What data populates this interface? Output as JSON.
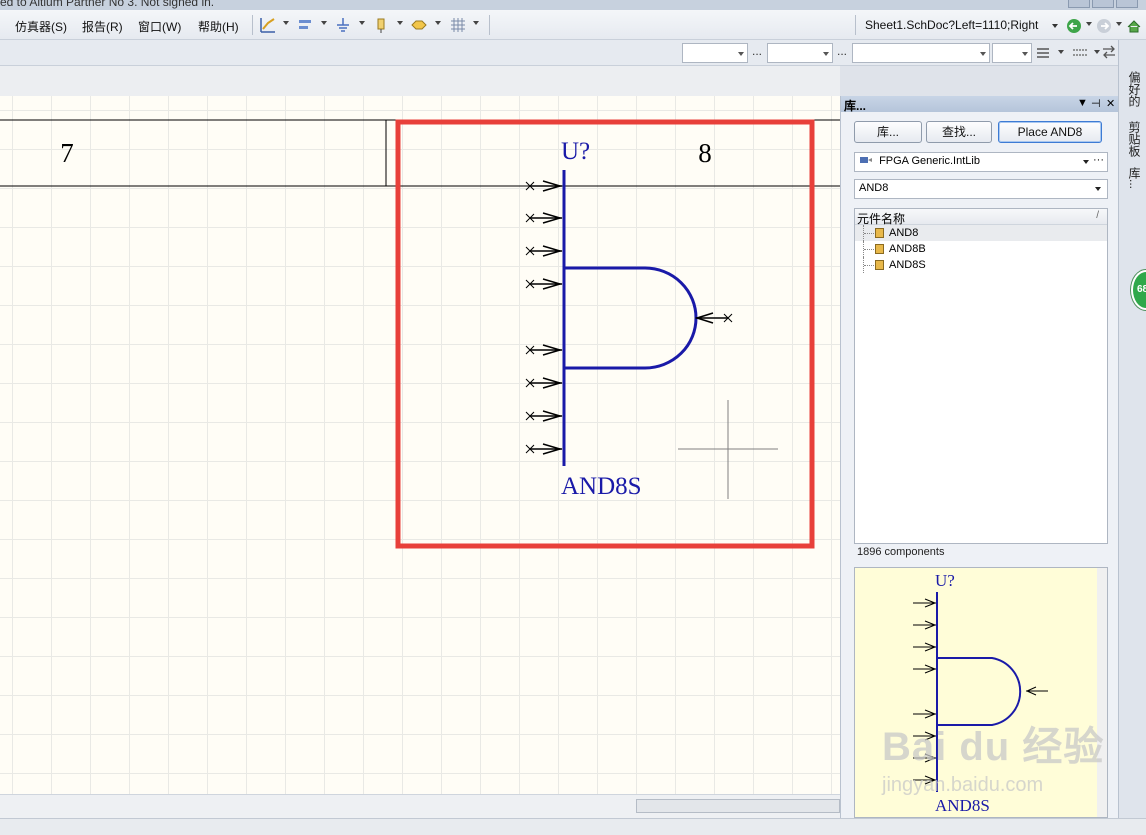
{
  "top_status": "ed to Altium Partner No 3. Not signed in.",
  "menu": {
    "items": [
      {
        "label": "仿真器(S)"
      },
      {
        "label": "报告(R)"
      },
      {
        "label": "窗口(W)"
      },
      {
        "label": "帮助(H)"
      }
    ]
  },
  "navigation": {
    "sheet_location": "Sheet1.SchDoc?Left=1110;Right"
  },
  "schematic": {
    "zone_label_left": "7",
    "zone_label_right": "8",
    "designator": "U?",
    "component_name": "AND8S"
  },
  "library_panel": {
    "title": "库...",
    "buttons": {
      "libraries": "库...",
      "search": "查找...",
      "place": "Place AND8"
    },
    "library_selected": "FPGA Generic.IntLib",
    "filter_value": "AND8",
    "list_header": "元件名称",
    "components": [
      {
        "name": "AND8"
      },
      {
        "name": "AND8B"
      },
      {
        "name": "AND8S"
      }
    ],
    "component_count": "1896 components",
    "preview": {
      "designator": "U?",
      "name": "AND8S"
    }
  },
  "side_tabs": [
    "偏好的",
    "剪贴板",
    "库..."
  ],
  "badge_value": "68",
  "colors": {
    "wire_blue": "#1a1aa8",
    "highlight_red": "#e8403a",
    "canvas_bg": "#fffdf6",
    "preview_bg": "#fffdd8"
  }
}
